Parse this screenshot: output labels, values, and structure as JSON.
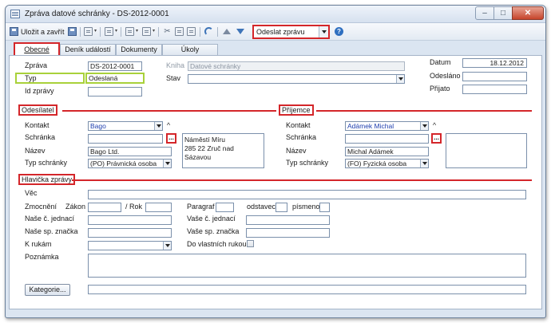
{
  "window": {
    "title": "Zpráva datové schránky - DS-2012-0001",
    "min_glyph": "–",
    "max_glyph": "□",
    "close_glyph": "✕"
  },
  "toolbar": {
    "save_close_label": "Uložit a zavřít",
    "send_combo_value": "Odeslat zprávu",
    "help_glyph": "?",
    "icons": [
      "save-icon",
      "save-as-icon",
      "print-icon",
      "preview-icon",
      "attach-icon",
      "cut-icon",
      "copy-icon",
      "paste-icon",
      "undo-icon",
      "arrow-up-icon",
      "arrow-down-icon",
      "help-icon"
    ]
  },
  "tabs": [
    {
      "label": "Obecné",
      "active": true
    },
    {
      "label": "Deník událostí",
      "active": false
    },
    {
      "label": "Dokumenty",
      "active": false
    },
    {
      "label": "Úkoly",
      "active": false
    }
  ],
  "general": {
    "zprava_label": "Zpráva",
    "zprava_value": "DS-2012-0001",
    "kniha_label": "Kniha",
    "kniha_value": "Datové schránky",
    "typ_label": "Typ",
    "typ_value": "Odeslaná",
    "stav_label": "Stav",
    "stav_value": "",
    "id_zpravy_label": "Id zprávy",
    "id_zpravy_value": "",
    "datum_label": "Datum",
    "datum_value": "18.12.2012",
    "odeslano_label": "Odesláno",
    "odeslano_value": "",
    "prijato_label": "Přijato",
    "prijato_value": ""
  },
  "odesilatel": {
    "header": "Odesílatel",
    "kontakt_label": "Kontakt",
    "kontakt_value": "Bago",
    "schranka_label": "Schránka",
    "schranka_value": "",
    "nazev_label": "Název",
    "nazev_value": "Bago Ltd.",
    "typ_schranky_label": "Typ schránky",
    "typ_schranky_value": "(PO)   Právnická osoba",
    "address_line1": "Náměstí Míru",
    "address_line2": "285 22 Zruč nad Sázavou",
    "ellipsis": "...",
    "caret": "^"
  },
  "prijemce": {
    "header": "Příjemce",
    "kontakt_label": "Kontakt",
    "kontakt_value": "Adámek Michal",
    "schranka_label": "Schránka",
    "schranka_value": "",
    "nazev_label": "Název",
    "nazev_value": "Michal Adámek",
    "typ_schranky_label": "Typ schránky",
    "typ_schranky_value": "(FO)   Fyzická osoba",
    "address": "",
    "ellipsis": "...",
    "caret": "^"
  },
  "hlavicka": {
    "header": "Hlavička zprávy",
    "vec_label": "Věc",
    "vec_value": "",
    "zmocneni_label": "Zmocnění",
    "zakon_label": "Zákon",
    "zakon_value": "",
    "rok_label": "/ Rok",
    "rok_value": "",
    "paragraf_label": "Paragraf",
    "paragraf_value": "",
    "odstavec_label": "odstavec",
    "odstavec_value": "",
    "pismeno_label": "písmeno",
    "pismeno_value": "",
    "nase_jednaci_label": "Naše č. jednací",
    "nase_jednaci_value": "",
    "vase_jednaci_label": "Vaše č. jednací",
    "vase_jednaci_value": "",
    "nase_znacka_label": "Naše sp. značka",
    "nase_znacka_value": "",
    "vase_znacka_label": "Vaše sp. značka",
    "vase_znacka_value": "",
    "k_rukam_label": "K rukám",
    "k_rukam_value": "",
    "do_vlastnich_label": "Do vlastních rukou",
    "do_vlastnich_checked": false,
    "poznamka_label": "Poznámka",
    "poznamka_value": "",
    "kategorie_button": "Kategorie...",
    "kategorie_value": ""
  },
  "colors": {
    "highlight_red": "#d4262a",
    "highlight_green": "#a9d13a",
    "link_blue": "#1f3fae",
    "window_frame": "#dbe5f1"
  }
}
